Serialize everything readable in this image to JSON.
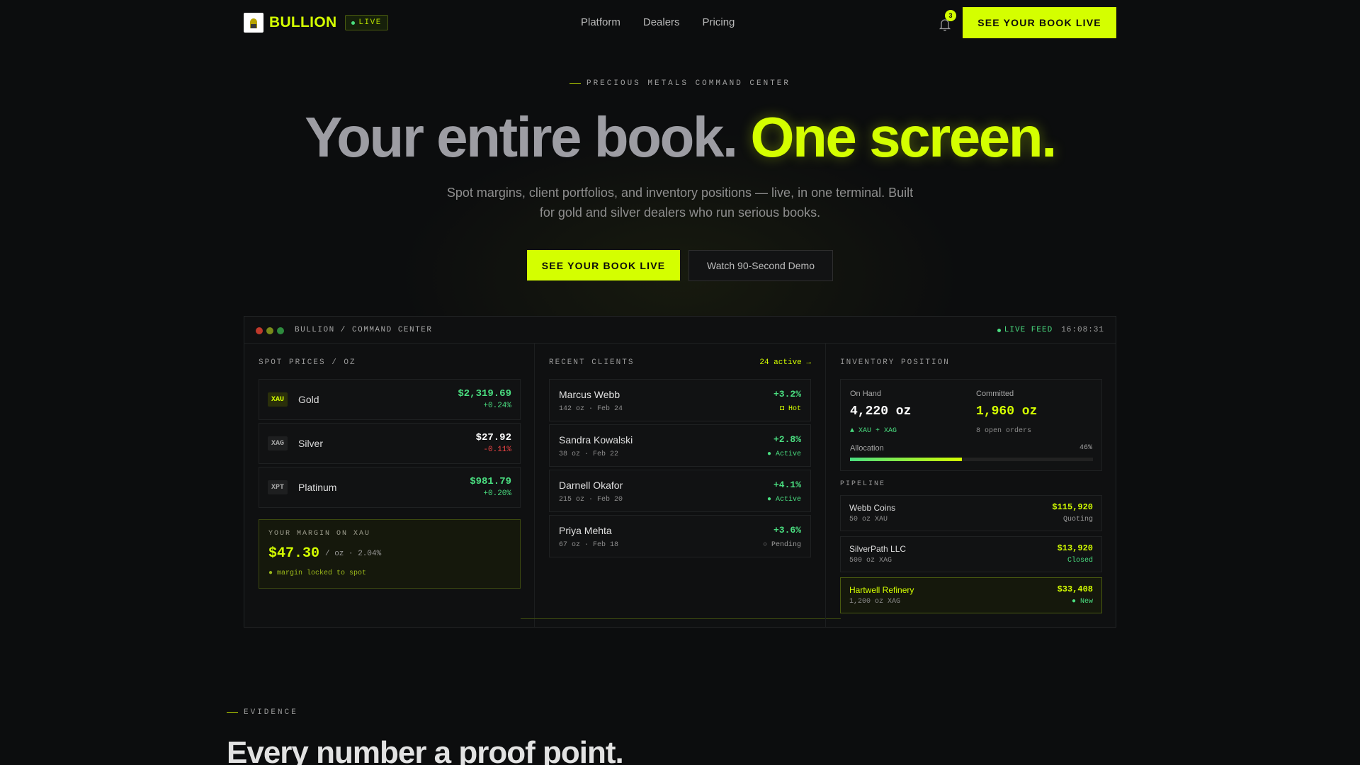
{
  "colors": {
    "accent": "#d4ff00",
    "positive": "#4ade80",
    "negative": "#ef4444"
  },
  "nav": {
    "logo_text": "BULLION",
    "live_badge": "LIVE",
    "links": [
      "Platform",
      "Dealers",
      "Pricing"
    ],
    "notification_count": "3",
    "cta": "SEE YOUR BOOK LIVE"
  },
  "hero": {
    "eyebrow": "PRECIOUS METALS COMMAND CENTER",
    "headline_a": "Your entire book.",
    "headline_b": "One screen.",
    "subtitle": "Spot margins, client portfolios, and inventory positions — live, in one terminal. Built for gold and silver dealers who run serious books.",
    "cta_primary": "SEE YOUR BOOK LIVE",
    "cta_secondary": "Watch 90-Second Demo"
  },
  "dashboard": {
    "title": "BULLION / COMMAND CENTER",
    "feed_label": "LIVE FEED",
    "time": "16:08:31",
    "spot": {
      "heading": "SPOT PRICES / OZ",
      "items": [
        {
          "ticker": "XAU",
          "name": "Gold",
          "price": "$2,319.69",
          "change": "+0.24%",
          "dir": "up"
        },
        {
          "ticker": "XAG",
          "name": "Silver",
          "price": "$27.92",
          "change": "-0.11%",
          "dir": "down"
        },
        {
          "ticker": "XPT",
          "name": "Platinum",
          "price": "$981.79",
          "change": "+0.20%",
          "dir": "up"
        }
      ],
      "margin": {
        "heading": "YOUR MARGIN ON XAU",
        "value": "$47.30",
        "unit": "/ oz · 2.04%",
        "note": "● margin locked to spot"
      }
    },
    "clients": {
      "heading": "RECENT CLIENTS",
      "link": "24 active →",
      "items": [
        {
          "name": "Marcus Webb",
          "meta": "142 oz · Feb 24",
          "pct": "+3.2%",
          "status": "◘ Hot"
        },
        {
          "name": "Sandra Kowalski",
          "meta": "38 oz · Feb 22",
          "pct": "+2.8%",
          "status": "● Active"
        },
        {
          "name": "Darnell Okafor",
          "meta": "215 oz · Feb 20",
          "pct": "+4.1%",
          "status": "● Active"
        },
        {
          "name": "Priya Mehta",
          "meta": "67 oz · Feb 18",
          "pct": "+3.6%",
          "status": "○ Pending"
        }
      ]
    },
    "inventory": {
      "heading": "INVENTORY POSITION",
      "on_hand_label": "On Hand",
      "on_hand_value": "4,220 oz",
      "on_hand_sub": "▲ XAU + XAG",
      "committed_label": "Committed",
      "committed_value": "1,960 oz",
      "committed_sub": "8 open orders",
      "allocation_label": "Allocation",
      "allocation_pct": "46%",
      "allocation_fraction": 0.46,
      "pipeline_heading": "PIPELINE",
      "pipeline": [
        {
          "name": "Webb Coins",
          "meta": "50 oz XAU",
          "value": "$115,920",
          "status": "Quoting"
        },
        {
          "name": "SilverPath LLC",
          "meta": "500 oz XAG",
          "value": "$13,920",
          "status": "Closed"
        },
        {
          "name": "Hartwell Refinery",
          "meta": "1,200 oz XAG",
          "value": "$33,408",
          "status": "● New"
        }
      ]
    }
  },
  "evidence": {
    "eyebrow": "EVIDENCE",
    "headline": "Every number a proof point."
  }
}
